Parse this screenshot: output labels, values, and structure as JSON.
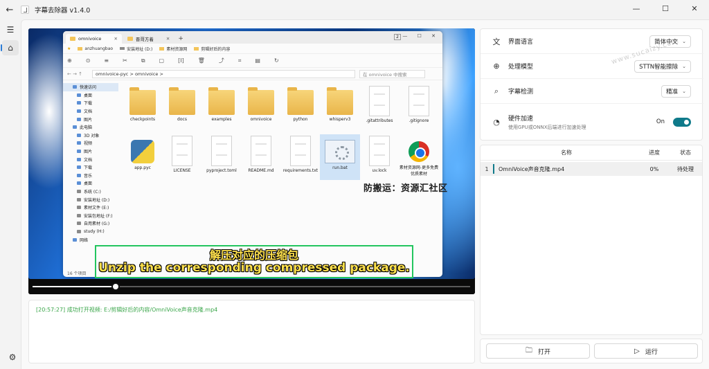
{
  "window": {
    "title": "字幕去除器 v1.4.0",
    "controls": [
      "—",
      "☐",
      "✕"
    ]
  },
  "rail": {
    "menu_icon": "hamburger-icon",
    "home_icon": "home-icon",
    "settings_icon": "gear-icon"
  },
  "video": {
    "progress": 0.19,
    "explorer": {
      "tabs": [
        "omnivoice",
        "晋哥方着"
      ],
      "tab_count": "2",
      "favorites": [
        "anzhuangbao",
        "安装地址 (D:)",
        "素材资源网",
        "剪辑好后的内容"
      ],
      "address": "omnivoice-pyc  >  omnivoice  >",
      "search_placeholder": "在 omnivoice 中搜索",
      "nav_items": [
        "快速访问",
        "桌面",
        "下载",
        "文档",
        "图片",
        "此电脑",
        "3D 对象",
        "视频",
        "图片",
        "文档",
        "下载",
        "音乐",
        "桌面",
        "系统 (C:)",
        "安装地址 (D:)",
        "素材文件 (E:)",
        "安装包地址 (F:)",
        "自用素材 (G:)",
        "study (H:)",
        "网络"
      ],
      "files": [
        {
          "name": "checkpoints",
          "kind": "folder"
        },
        {
          "name": "docs",
          "kind": "folder"
        },
        {
          "name": "examples",
          "kind": "folder"
        },
        {
          "name": "omnivoice",
          "kind": "folder"
        },
        {
          "name": "python",
          "kind": "folder"
        },
        {
          "name": "whisperv3",
          "kind": "folder"
        },
        {
          "name": ".gitattributes",
          "kind": "doc"
        },
        {
          "name": ".gitignore",
          "kind": "doc"
        },
        {
          "name": "app.pyc",
          "kind": "py"
        },
        {
          "name": "LICENSE",
          "kind": "doc"
        },
        {
          "name": "pyproject.toml",
          "kind": "doc"
        },
        {
          "name": "README.md",
          "kind": "doc"
        },
        {
          "name": "requirements.txt",
          "kind": "doc"
        },
        {
          "name": "run.bat",
          "kind": "bat"
        },
        {
          "name": "uv.lock",
          "kind": "doc"
        },
        {
          "name": "素材资源网-更多免费优质素材",
          "kind": "chrome"
        }
      ],
      "status": "16 个项目"
    },
    "watermark": "防搬运：资源汇社区",
    "subtitle_cn": "解压对应的压缩包",
    "subtitle_en": "Unzip the corresponding compressed package."
  },
  "log": {
    "line": "[20:57:27] 成功打开视频: E:/剪辑好后的内容/OmniVoice声音克隆.mp4"
  },
  "settings": {
    "watermark": "www.sucaizy.com",
    "rows": [
      {
        "label": "界面语言",
        "value": "简体中文",
        "icon": "language-icon"
      },
      {
        "label": "处理模型",
        "value": "STTN智能擦除",
        "icon": "globe-icon"
      },
      {
        "label": "字幕检测",
        "value": "精准",
        "icon": "search-icon"
      },
      {
        "label": "硬件加速",
        "desc": "使用GPU或ONNX后端进行加速处理",
        "value": "On",
        "icon": "speedometer-icon"
      }
    ]
  },
  "table": {
    "headers": {
      "name": "名称",
      "progress": "进度",
      "status": "状态"
    },
    "rows": [
      {
        "index": "1",
        "name": "OmniVoice声音克隆.mp4",
        "progress": "0%",
        "status": "待处理"
      }
    ]
  },
  "actions": {
    "open": "打开",
    "run": "运行"
  }
}
